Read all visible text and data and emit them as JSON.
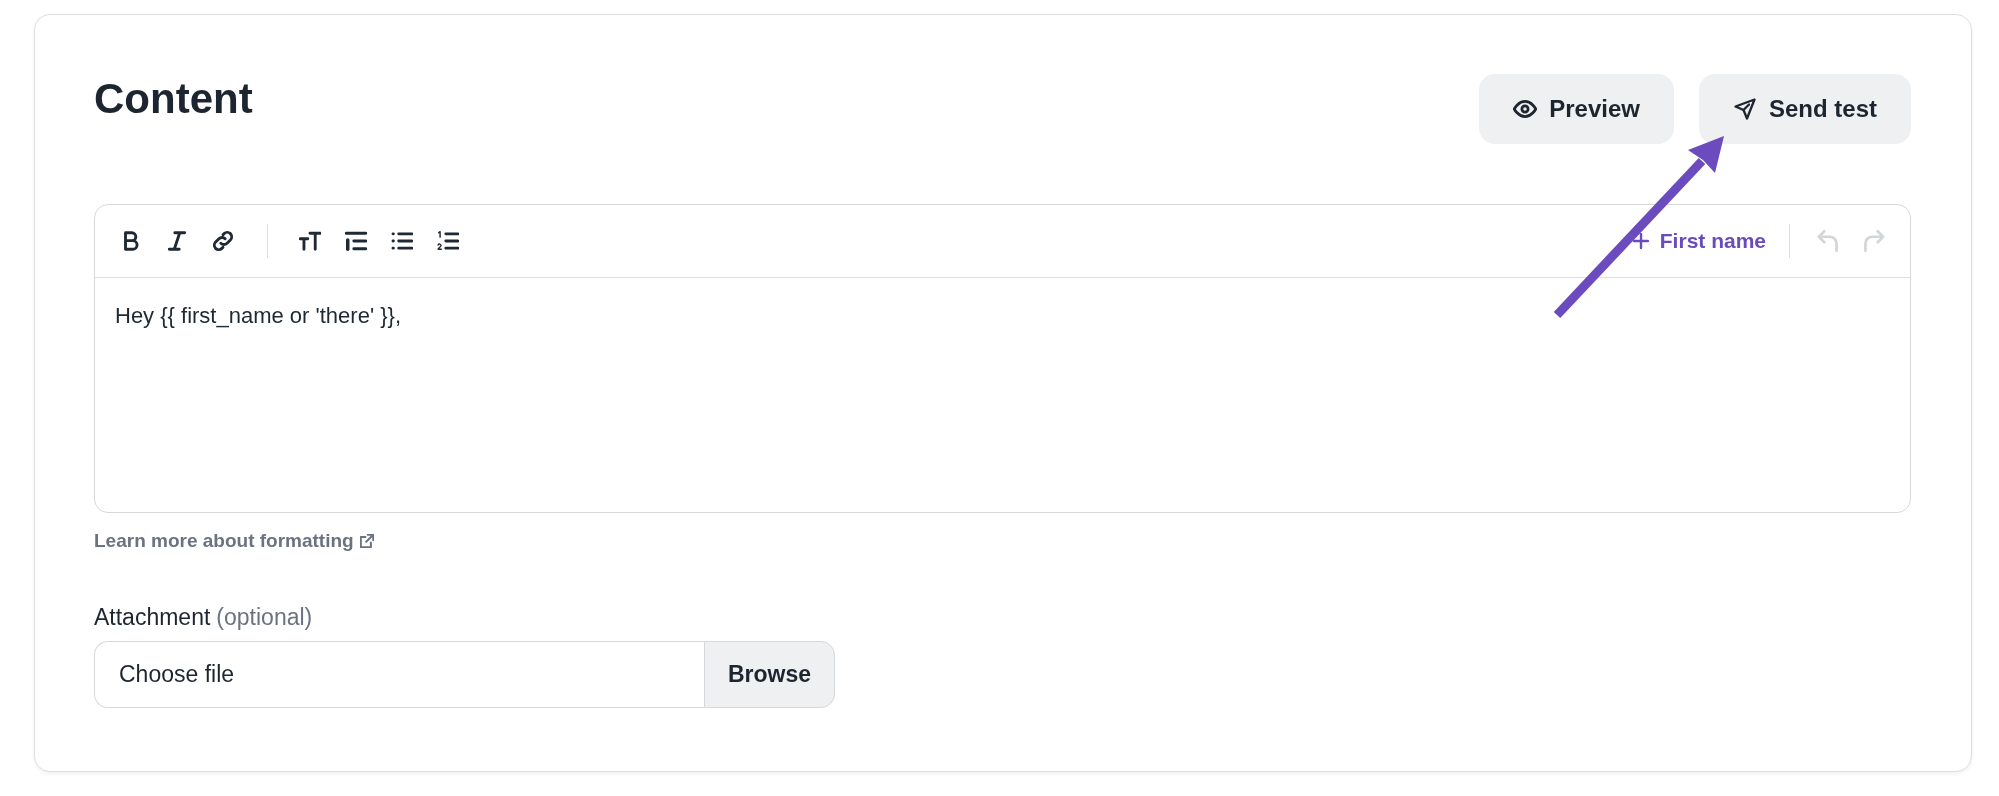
{
  "section": {
    "title": "Content"
  },
  "actions": [
    {
      "kind": "preview",
      "label": "Preview"
    },
    {
      "kind": "send",
      "label": "Send test"
    }
  ],
  "editor": {
    "toolbar_groups": [
      {
        "tools": [
          {
            "kind": "bold"
          },
          {
            "kind": "italic"
          },
          {
            "kind": "link"
          }
        ]
      },
      {
        "tools": [
          {
            "kind": "text_size"
          },
          {
            "kind": "quote"
          },
          {
            "kind": "bullet_list"
          },
          {
            "kind": "numbered_list"
          }
        ]
      }
    ],
    "insert_variable": {
      "label": "First name"
    },
    "history": [
      {
        "kind": "undo",
        "disabled": true
      },
      {
        "kind": "redo",
        "disabled": true
      }
    ],
    "content": "Hey {{ first_name or 'there' }},"
  },
  "help_link": {
    "label": "Learn more about formatting"
  },
  "attachment": {
    "label": "Attachment",
    "hint": "(optional)",
    "file_text": "Choose file",
    "button": "Browse"
  },
  "annotation": {
    "kind": "arrow"
  }
}
